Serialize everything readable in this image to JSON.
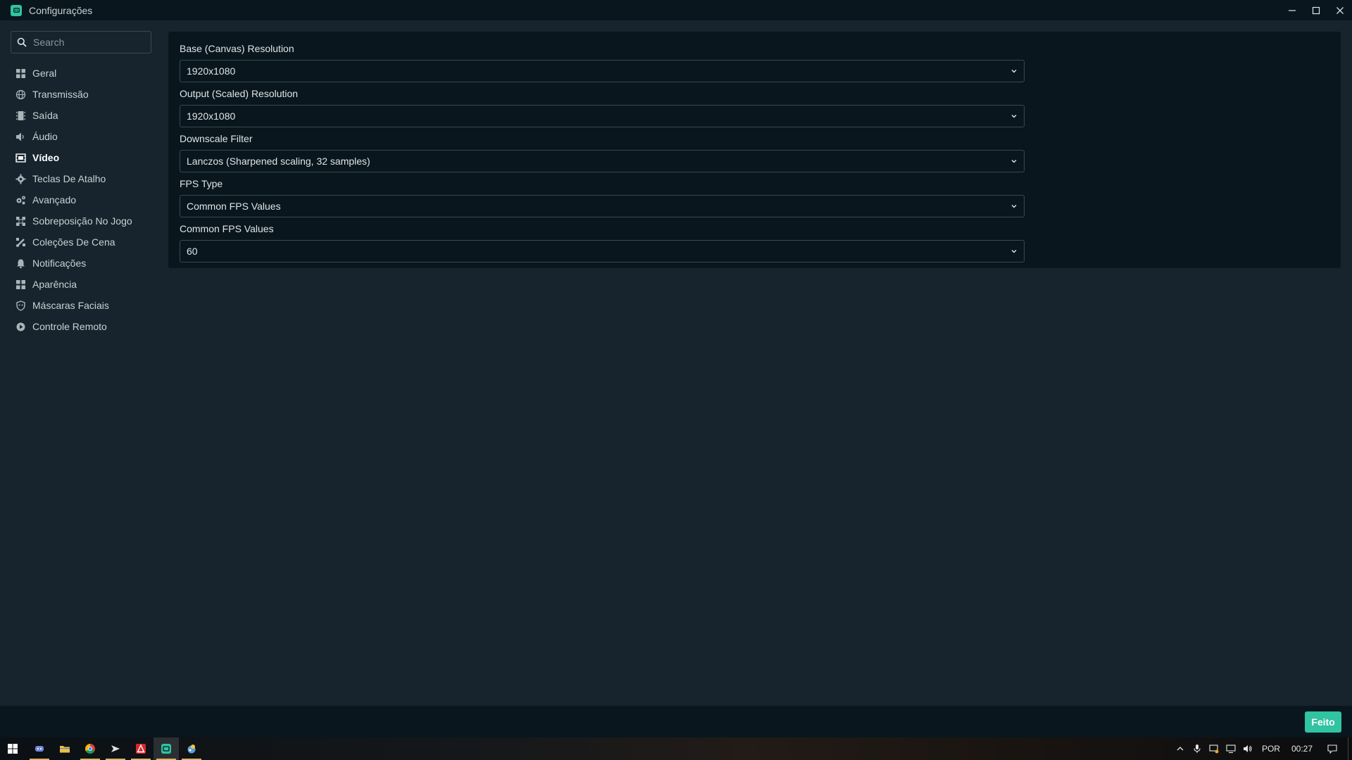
{
  "window": {
    "title": "Configurações",
    "controls": [
      "minimize",
      "maximize",
      "close"
    ]
  },
  "sidebar": {
    "search_placeholder": "Search",
    "items": [
      {
        "label": "Geral",
        "icon": "grid-icon",
        "active": false
      },
      {
        "label": "Transmissão",
        "icon": "globe-icon",
        "active": false
      },
      {
        "label": "Saída",
        "icon": "film-strip-icon",
        "active": false
      },
      {
        "label": "Áudio",
        "icon": "speaker-icon",
        "active": false
      },
      {
        "label": "Vídeo",
        "icon": "video-icon",
        "active": true
      },
      {
        "label": "Teclas De Atalho",
        "icon": "gear-icon",
        "active": false
      },
      {
        "label": "Avançado",
        "icon": "gears-icon",
        "active": false
      },
      {
        "label": "Sobreposição No Jogo",
        "icon": "overlay-icon",
        "active": false
      },
      {
        "label": "Coleções De Cena",
        "icon": "brush-icon",
        "active": false
      },
      {
        "label": "Notificações",
        "icon": "bell-icon",
        "active": false
      },
      {
        "label": "Aparência",
        "icon": "grid-icon",
        "active": false
      },
      {
        "label": "Máscaras Faciais",
        "icon": "shield-icon",
        "active": false
      },
      {
        "label": "Controle Remoto",
        "icon": "remote-icon",
        "active": false
      }
    ]
  },
  "video_settings": {
    "fields": [
      {
        "label": "Base (Canvas) Resolution",
        "value": "1920x1080"
      },
      {
        "label": "Output (Scaled) Resolution",
        "value": "1920x1080"
      },
      {
        "label": "Downscale Filter",
        "value": "Lanczos (Sharpened scaling, 32 samples)"
      },
      {
        "label": "FPS Type",
        "value": "Common FPS Values"
      },
      {
        "label": "Common FPS Values",
        "value": "60"
      }
    ]
  },
  "footer": {
    "done_label": "Feito"
  },
  "colors": {
    "accent": "#31c3a2",
    "background": "#17242d",
    "panel": "#09161d"
  },
  "taskbar": {
    "apps": [
      "windows-start-icon",
      "discord-icon",
      "file-explorer-icon",
      "chrome-icon",
      "app-icon",
      "acrobat-icon",
      "streamlabs-icon",
      "pinball-icon"
    ],
    "tray": {
      "language": "POR",
      "time": "00:27"
    }
  }
}
